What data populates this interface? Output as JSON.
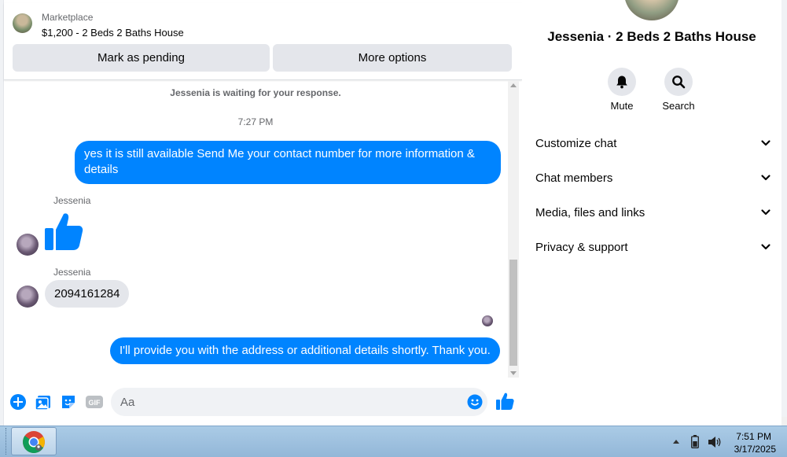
{
  "marketplace": {
    "label": "Marketplace",
    "listing_title": "$1,200 - 2 Beds 2 Baths House",
    "mark_pending_label": "Mark as pending",
    "more_options_label": "More options"
  },
  "conversation": {
    "status_note": "Jessenia is waiting for your response.",
    "timestamp": "7:27 PM",
    "messages": [
      {
        "from": "me",
        "text": "yes it is still available Send Me your contact number for more information & details"
      },
      {
        "from": "Jessenia",
        "sender_label": "Jessenia",
        "type": "like"
      },
      {
        "from": "Jessenia",
        "sender_label": "Jessenia",
        "text": "2094161284"
      },
      {
        "from": "me",
        "text": "I'll provide you with the address or additional details shortly. Thank you."
      }
    ]
  },
  "composer": {
    "placeholder": "Aa",
    "icons": [
      "plus-icon",
      "photo-icon",
      "sticker-icon",
      "gif-icon",
      "emoji-icon",
      "like-icon"
    ],
    "gif_label": "GIF"
  },
  "info_panel": {
    "name": "Jessenia · 2 Beds 2 Baths House",
    "actions": [
      {
        "label": "Mute",
        "icon": "bell-icon"
      },
      {
        "label": "Search",
        "icon": "search-icon"
      }
    ],
    "menu": [
      {
        "label": "Customize chat"
      },
      {
        "label": "Chat members"
      },
      {
        "label": "Media, files and links"
      },
      {
        "label": "Privacy & support"
      }
    ]
  },
  "taskbar": {
    "time": "7:51 PM",
    "date": "3/17/2025",
    "pinned": [
      "chrome-icon"
    ]
  },
  "colors": {
    "accent": "#0084ff",
    "incoming_bubble": "#e4e6eb",
    "taskbar": "#a7c7e4"
  }
}
